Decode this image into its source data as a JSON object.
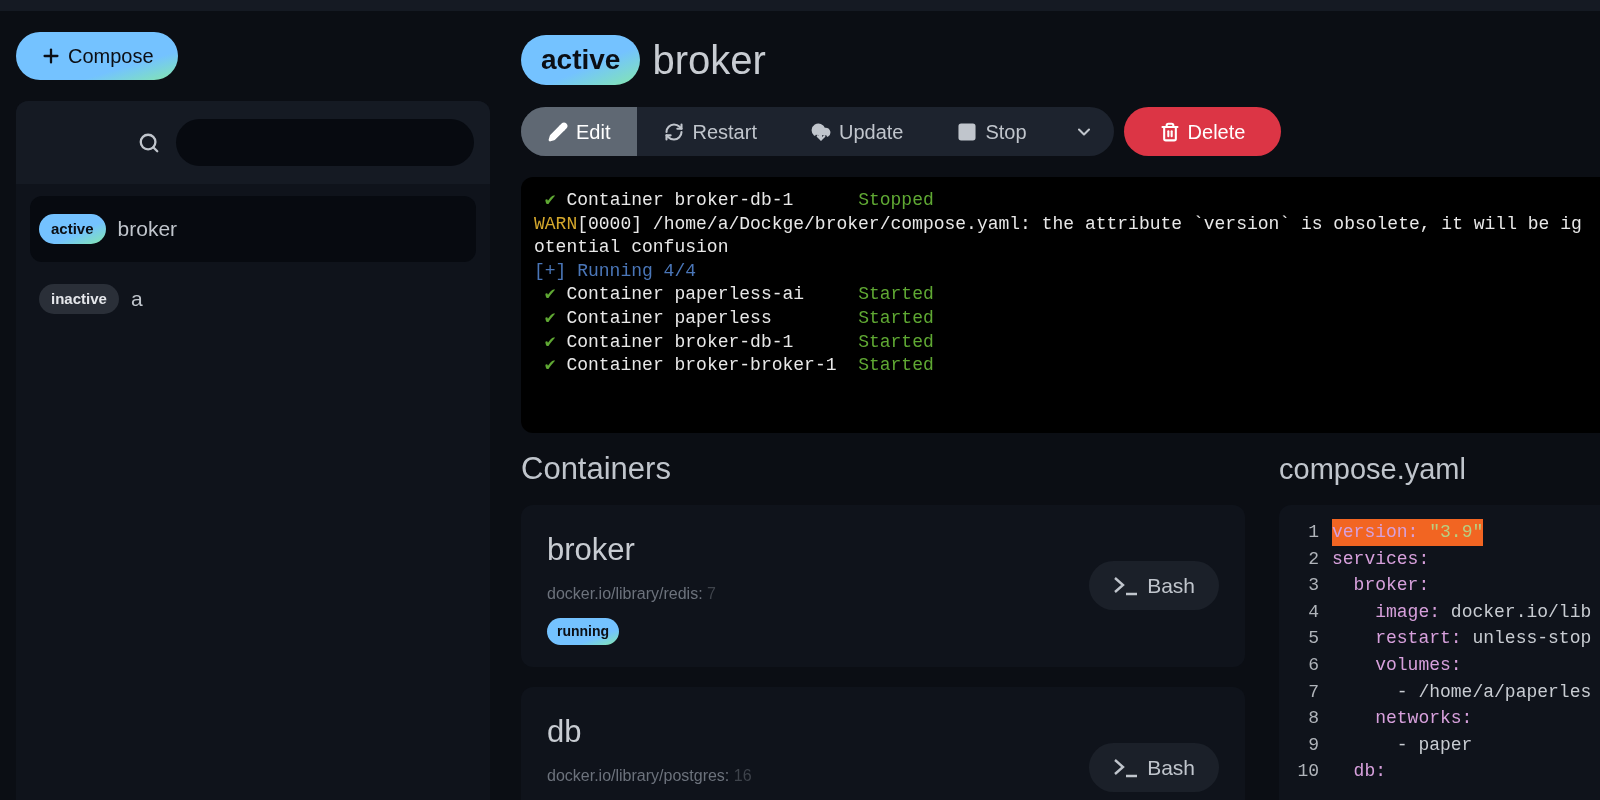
{
  "compose_button": {
    "label": "Compose"
  },
  "sidebar": {
    "items": [
      {
        "status": "active",
        "name": "broker",
        "selected": true
      },
      {
        "status": "inactive",
        "name": "a",
        "selected": false
      }
    ]
  },
  "header": {
    "status": "active",
    "title": "broker"
  },
  "toolbar": {
    "actions": [
      {
        "kind": "edit",
        "label": "Edit",
        "selected": true
      },
      {
        "kind": "restart",
        "label": "Restart",
        "selected": false
      },
      {
        "kind": "update",
        "label": "Update",
        "selected": false
      },
      {
        "kind": "stop",
        "label": "Stop",
        "selected": false
      },
      {
        "kind": "more",
        "selected": false
      }
    ],
    "delete": {
      "label": "Delete"
    }
  },
  "terminal": {
    "lines": [
      {
        "kind": "status",
        "mark": "✔",
        "text": "Container broker-db-1      ",
        "status": "Stopped"
      },
      {
        "kind": "warn",
        "tag": "WARN",
        "text": "[0000] /home/a/Dockge/broker/compose.yaml: the attribute `version` is obsolete, it will be ig"
      },
      {
        "kind": "plain",
        "text": "otential confusion"
      },
      {
        "kind": "info",
        "text": "[+] Running 4/4"
      },
      {
        "kind": "status",
        "mark": "✔",
        "text": "Container paperless-ai     ",
        "status": "Started"
      },
      {
        "kind": "status",
        "mark": "✔",
        "text": "Container paperless        ",
        "status": "Started"
      },
      {
        "kind": "status",
        "mark": "✔",
        "text": "Container broker-db-1      ",
        "status": "Started"
      },
      {
        "kind": "status",
        "mark": "✔",
        "text": "Container broker-broker-1  ",
        "status": "Started"
      }
    ]
  },
  "containers": {
    "title": "Containers",
    "items": [
      {
        "name": "broker",
        "image": "docker.io/library/redis:",
        "tag": "7",
        "state": "running",
        "button": "Bash"
      },
      {
        "name": "db",
        "image": "docker.io/library/postgres:",
        "tag": "16",
        "button": "Bash"
      }
    ]
  },
  "compose_file": {
    "title": "compose.yaml",
    "lines": [
      {
        "number": "1",
        "key": "version:",
        "value": " \"3.9\"",
        "kind": "string",
        "highlighted": true
      },
      {
        "number": "2",
        "key": "services:",
        "highlighted": false
      },
      {
        "number": "3",
        "key": "  broker:",
        "highlighted": false
      },
      {
        "number": "4",
        "key": "    image:",
        "value": " docker.io/lib",
        "highlighted": false
      },
      {
        "number": "5",
        "key": "    restart:",
        "value": " unless-stop",
        "highlighted": false
      },
      {
        "number": "6",
        "key": "    volumes:",
        "highlighted": false
      },
      {
        "number": "7",
        "value": "      - /home/a/paperles",
        "highlighted": false
      },
      {
        "number": "8",
        "key": "    networks:",
        "highlighted": false
      },
      {
        "number": "9",
        "value": "      - paper",
        "highlighted": false
      },
      {
        "number": "10",
        "key": "  db:",
        "highlighted": false
      }
    ]
  }
}
